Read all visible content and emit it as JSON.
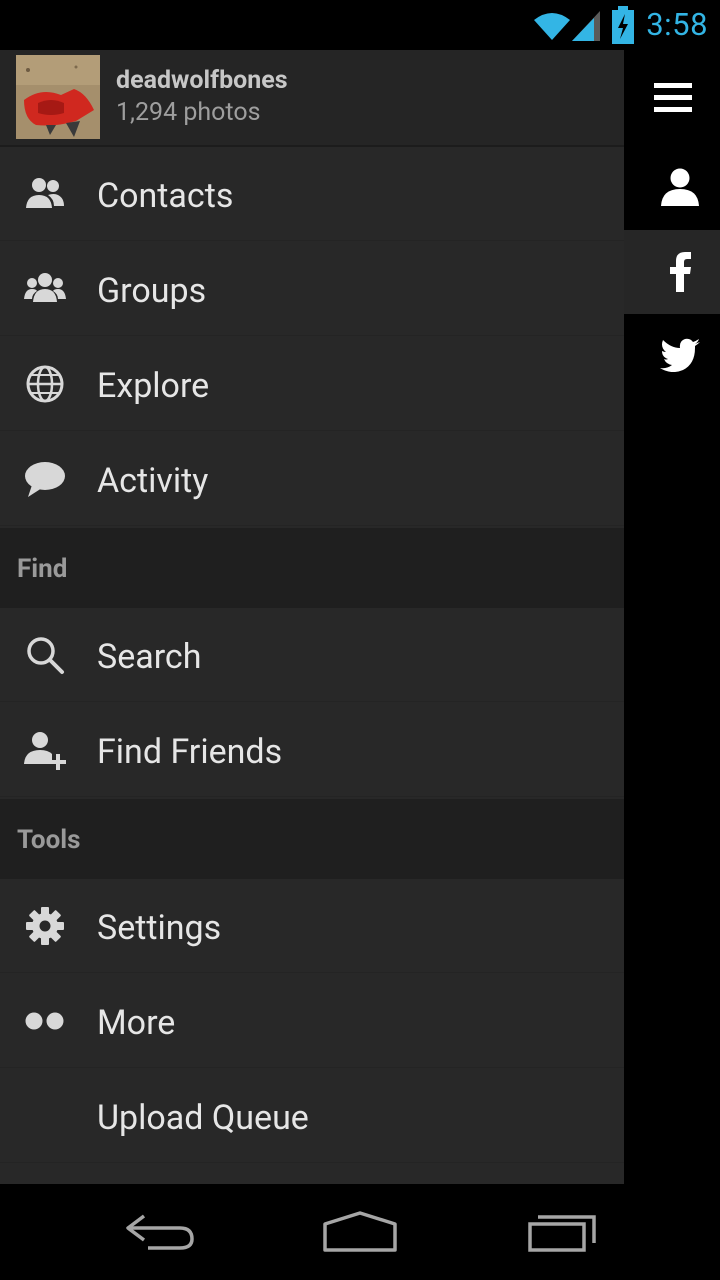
{
  "status_bar": {
    "time": "3:58",
    "accent_color": "#33b5e5",
    "icons": [
      "wifi-icon",
      "signal-icon",
      "battery-charging-icon"
    ]
  },
  "profile": {
    "username": "deadwolfbones",
    "photo_count": "1,294 photos"
  },
  "menu": {
    "items": [
      {
        "label": "Contacts",
        "icon": "contacts-icon"
      },
      {
        "label": "Groups",
        "icon": "groups-icon"
      },
      {
        "label": "Explore",
        "icon": "globe-icon"
      },
      {
        "label": "Activity",
        "icon": "speech-bubble-icon"
      }
    ],
    "find_header": "Find",
    "find_items": [
      {
        "label": "Search",
        "icon": "search-icon"
      },
      {
        "label": "Find Friends",
        "icon": "add-person-icon"
      }
    ],
    "tools_header": "Tools",
    "tools_items": [
      {
        "label": "Settings",
        "icon": "gear-icon"
      },
      {
        "label": "More",
        "icon": "more-dots-icon"
      },
      {
        "label": "Upload Queue",
        "icon": ""
      }
    ]
  },
  "rail": {
    "buttons": [
      "menu-icon",
      "person-icon",
      "facebook-icon",
      "twitter-icon"
    ],
    "selected": "facebook-icon"
  },
  "nav_bar": {
    "buttons": [
      "back-icon",
      "home-icon",
      "recent-apps-icon"
    ]
  }
}
